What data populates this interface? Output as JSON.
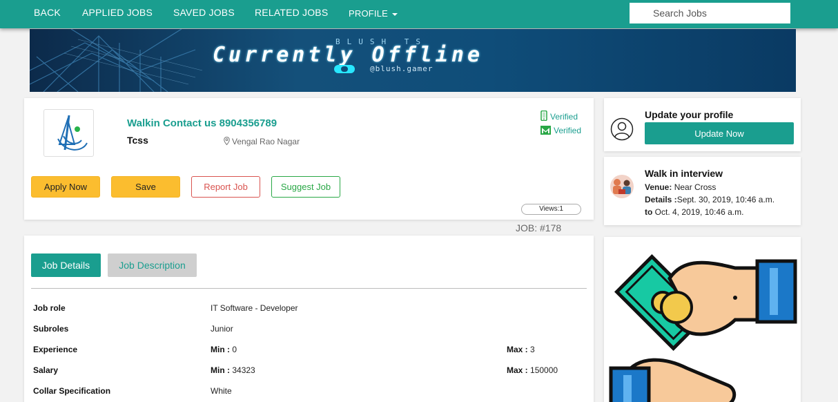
{
  "nav": {
    "back": "BACK",
    "applied": "APPLIED JOBS",
    "saved": "SAVED JOBS",
    "related": "RELATED JOBS",
    "profile": "PROFILE",
    "search_placeholder": "Search Jobs"
  },
  "banner": {
    "top_text": "BLUSH TS",
    "title": "Currently Offline",
    "handle": "@blush.gamer"
  },
  "job": {
    "contact": "Walkin Contact us 8904356789",
    "company": "Tcss",
    "location": "Vengal Rao Nagar",
    "phone_verified": "Verified",
    "email_verified": "Verified",
    "views": "Views:1",
    "job_number": "JOB: #178",
    "actions": {
      "apply": "Apply Now",
      "save": "Save",
      "report": "Report Job",
      "suggest": "Suggest Job"
    }
  },
  "profile": {
    "title": "Update your profile",
    "button": "Update Now"
  },
  "walkin": {
    "title": "Walk in interview",
    "venue_label": "Venue:",
    "venue": "Near Cross",
    "details_label": "Details :",
    "from": "Sept. 30, 2019, 10:46 a.m.",
    "to_label": "to",
    "to": "Oct. 4, 2019, 10:46 a.m."
  },
  "tabs": {
    "details": "Job Details",
    "description": "Job Description"
  },
  "details": {
    "job_role_label": "Job role",
    "job_role": "IT Software - Developer",
    "subroles_label": "Subroles",
    "subroles": "Junior",
    "experience_label": "Experience",
    "exp_min_label": "Min :",
    "exp_min": "0",
    "exp_max_label": "Max :",
    "exp_max": "3",
    "salary_label": "Salary",
    "sal_min_label": "Min :",
    "sal_min": "34323",
    "sal_max_label": "Max :",
    "sal_max": "150000",
    "collar_label": "Collar Specification",
    "collar": "White"
  },
  "colors": {
    "primary": "#1a9e8f",
    "accent_yellow": "#fbbd2f",
    "danger": "#d9534f",
    "success": "#28a745"
  }
}
